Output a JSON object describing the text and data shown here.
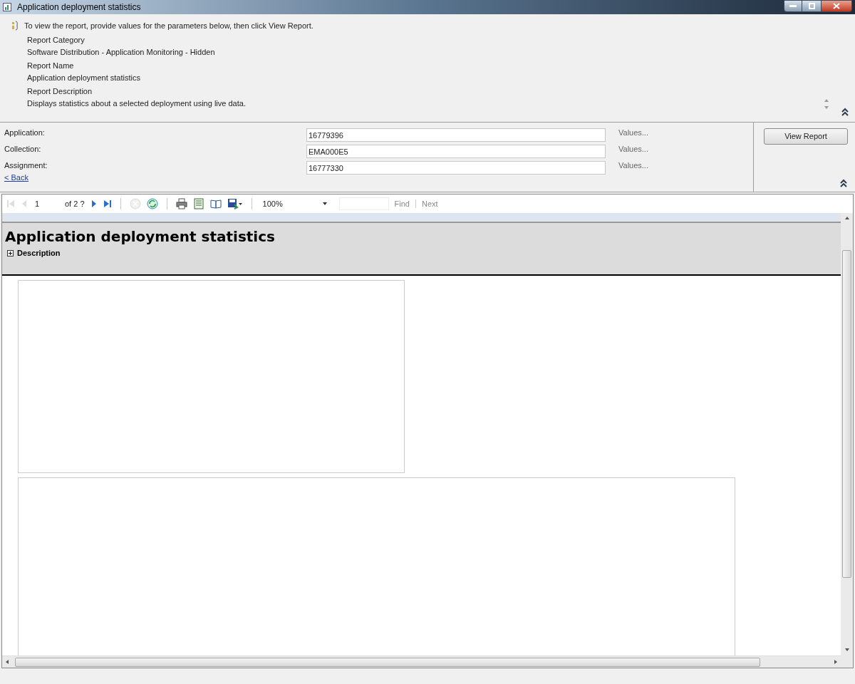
{
  "window": {
    "title": "Application deployment statistics"
  },
  "info": {
    "message": "To view the report, provide values for the parameters below, then click View Report.",
    "fields": [
      {
        "label": "Report Category",
        "value": "Software Distribution - Application Monitoring - Hidden"
      },
      {
        "label": "Report Name",
        "value": "Application deployment statistics"
      },
      {
        "label": "Report Description",
        "value": "Displays statistics about a selected deployment using live data."
      }
    ]
  },
  "parameters": [
    {
      "label": "Application:",
      "value": "16779396",
      "link": "Values..."
    },
    {
      "label": "Collection:",
      "value": "EMA000E5",
      "link": "Values..."
    },
    {
      "label": "Assignment:",
      "value": "16777330",
      "link": "Values..."
    }
  ],
  "back_link": "< Back",
  "view_report_button": "View Report",
  "toolbar": {
    "page": "1",
    "page_of": "of 2 ?",
    "zoom": "100%",
    "find": "Find",
    "next": "Next",
    "buttons": [
      {
        "kind": "first",
        "disabled": true
      },
      {
        "kind": "previous",
        "disabled": true
      },
      {
        "kind": "next",
        "disabled": false
      },
      {
        "kind": "last",
        "disabled": false
      },
      {
        "kind": "stop",
        "disabled": true
      },
      {
        "kind": "refresh",
        "disabled": false
      },
      {
        "kind": "print",
        "disabled": false
      },
      {
        "kind": "layout",
        "disabled": false
      },
      {
        "kind": "page_setup",
        "disabled": false
      },
      {
        "kind": "export",
        "disabled": false
      }
    ]
  },
  "report": {
    "title": "Application deployment statistics",
    "description_toggle": "Description"
  }
}
